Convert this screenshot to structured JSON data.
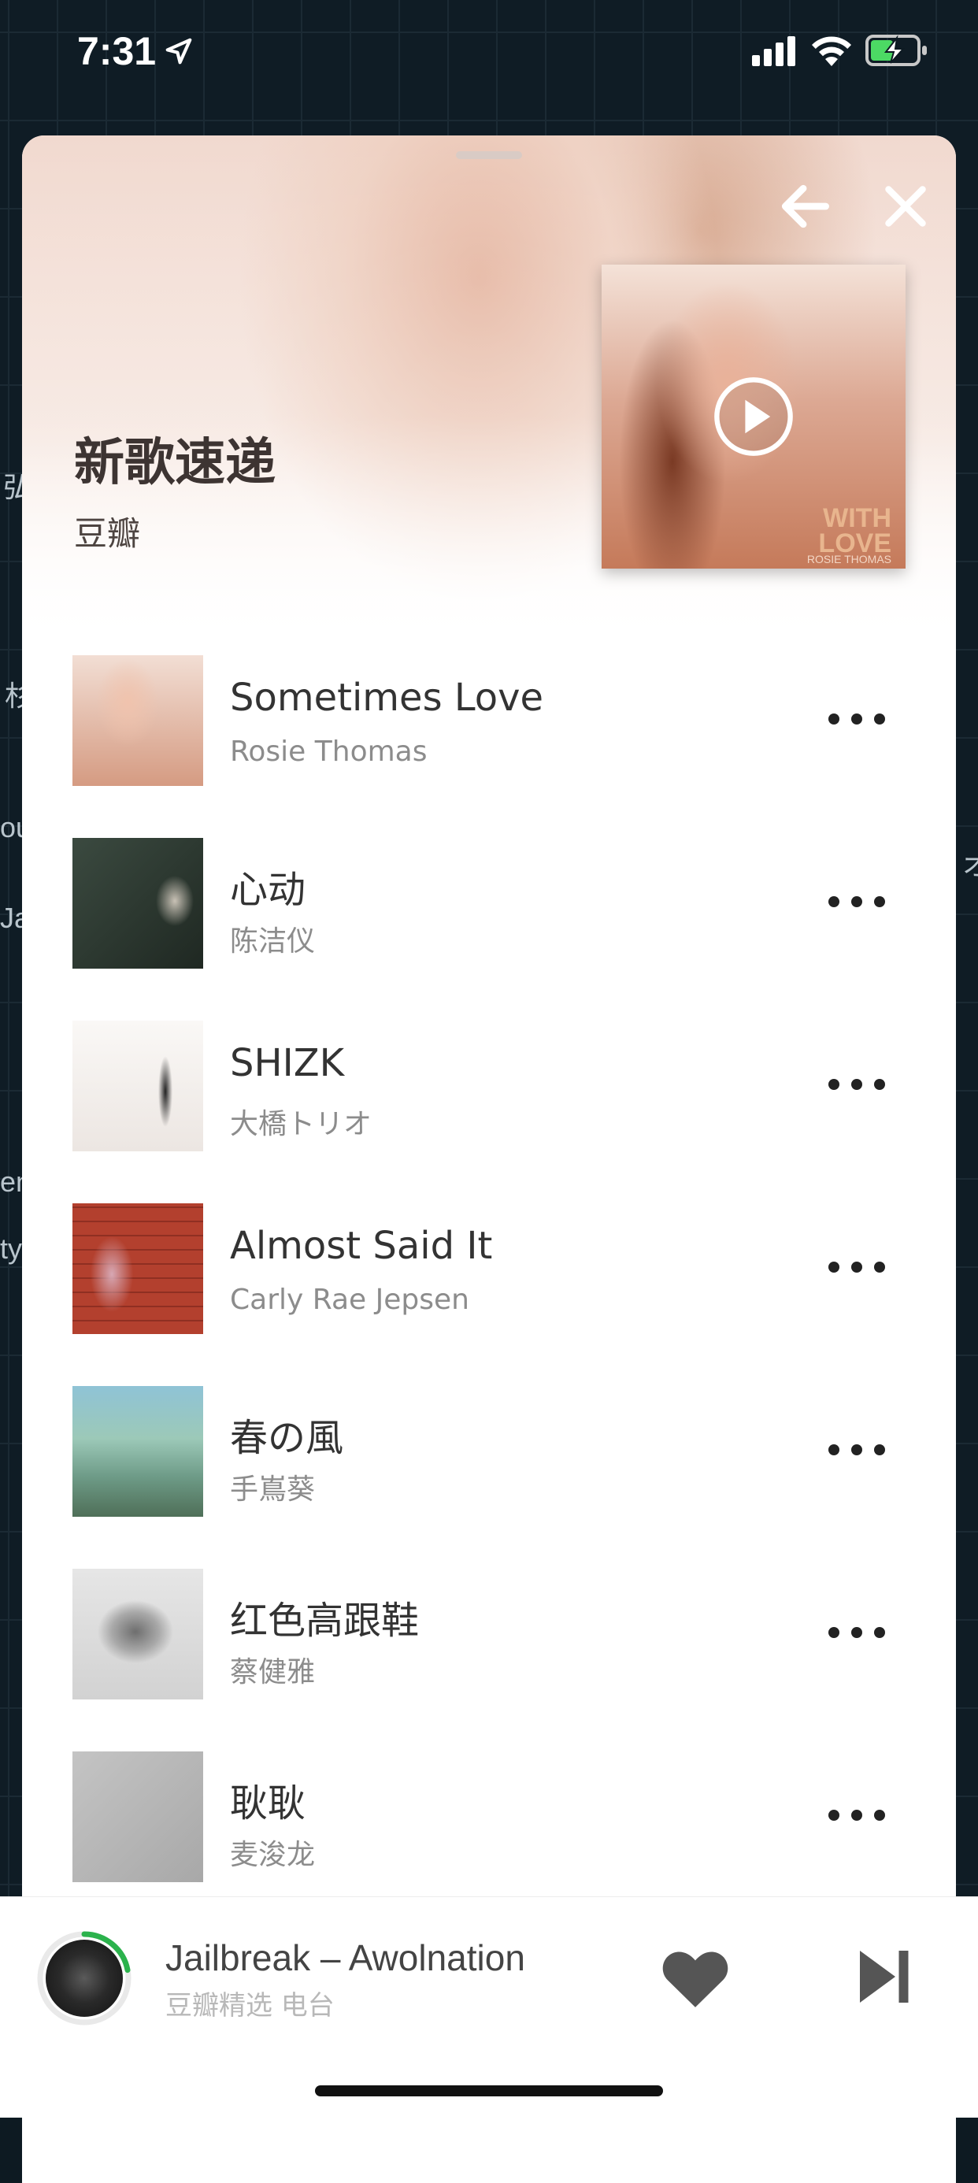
{
  "status_bar": {
    "time": "7:31"
  },
  "background_fragments": [
    "弘",
    "杉",
    "ou",
    "Ja",
    "en",
    "ty",
    "オ"
  ],
  "header": {
    "title": "新歌速递",
    "curator": "豆瓣"
  },
  "cover": {
    "line1": "WITH",
    "line2": "LOVE",
    "artist": "ROSIE THOMAS"
  },
  "tracks": [
    {
      "title": "Sometimes Love",
      "artist": "Rosie Thomas",
      "thumb_color": "#e3b7a3"
    },
    {
      "title": "心动",
      "artist": "陈洁仪",
      "thumb_color": "#2f3a34"
    },
    {
      "title": "SHIZK",
      "artist": "大橋トリオ",
      "thumb_color": "#f4f1ee"
    },
    {
      "title": "Almost Said It",
      "artist": "Carly Rae Jepsen",
      "thumb_color": "#b3402e"
    },
    {
      "title": "春の風",
      "artist": "手嶌葵",
      "thumb_color": "#6d9a86"
    },
    {
      "title": "红色高跟鞋",
      "artist": "蔡健雅",
      "thumb_color": "#cfcfcf"
    },
    {
      "title": "耿耿",
      "artist": "麦浚龙",
      "thumb_color": "#b5b5b5"
    }
  ],
  "mini_player": {
    "title": "Jailbreak – Awolnation",
    "subtitle": "豆瓣精选 电台",
    "progress": 0.22,
    "accent": "#2bb24c"
  }
}
